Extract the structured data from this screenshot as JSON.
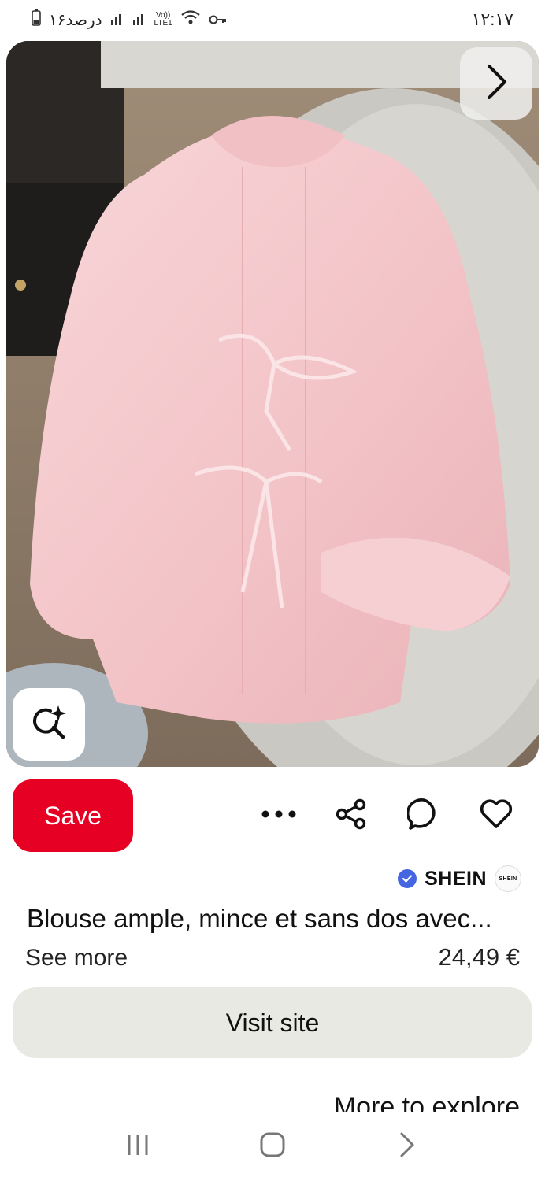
{
  "status_bar": {
    "time": "۱۲:۱۷",
    "battery_text": "۱۶درصد",
    "network_label": "LTE1",
    "icons": [
      "battery-icon",
      "signal-icon",
      "signal-icon",
      "volte-icon",
      "wifi-icon",
      "vpn-key-icon"
    ]
  },
  "pin": {
    "image_alt": "Pink ample blouse with back ties",
    "save_label": "Save",
    "actions": [
      "more-icon",
      "share-icon",
      "comment-icon",
      "heart-icon"
    ],
    "brand": {
      "name": "SHEIN",
      "logo_text": "SHEIN",
      "verified": true
    },
    "title": "Blouse ample, mince et sans dos avec...",
    "see_more": "See more",
    "price": "24,49 €",
    "visit_label": "Visit site"
  },
  "more_to_explore": "More to explore",
  "colors": {
    "save": "#e60023",
    "visit_bg": "#e9e9e4",
    "verified": "#4566e0",
    "blouse": "#f4c9cc"
  },
  "nav": [
    "recents-icon",
    "home-icon",
    "back-icon"
  ]
}
